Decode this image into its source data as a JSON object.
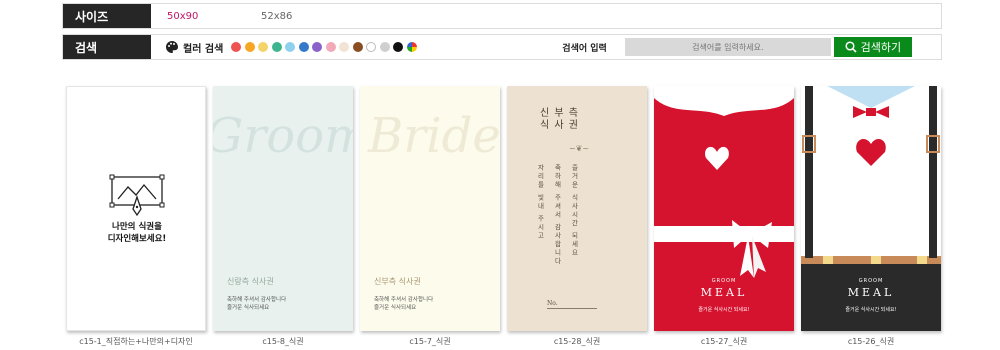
{
  "filter": {
    "size_label": "사이즈",
    "sizes": [
      "50x90",
      "52x86"
    ],
    "search_label": "검색",
    "color_search_label": "컬러 검색",
    "colors": [
      "#ee5252",
      "#f5a623",
      "#f4d36a",
      "#3cb58e",
      "#8fd0ee",
      "#3579c9",
      "#8a62c9",
      "#f2a9b8",
      "#f1e4d4",
      "#8a4d22",
      "#ffffff",
      "#cfcfcf",
      "#111111"
    ],
    "keyword_label": "검색어 입력",
    "keyword_placeholder": "검색어를 입력하세요.",
    "search_button": "검색하기"
  },
  "cards": [
    {
      "caption": "c15-1_직접하는+나만의+디자인",
      "diy_line1": "나만의 식권을",
      "diy_line2": "디자인해보세요!"
    },
    {
      "caption": "c15-8_식권",
      "script": "Groom",
      "title": "신랑측 식사권",
      "text1": "축하해 주셔서 감사합니다",
      "text2": "즐거운 식사되세요"
    },
    {
      "caption": "c15-7_식권",
      "script": "Bride",
      "title": "신부측 식사권",
      "text1": "축하해 주셔서 감사합니다",
      "text2": "즐거운 식사되세요"
    },
    {
      "caption": "c15-28_식권",
      "title1": "신 부 측",
      "title2": "식 사 권",
      "col1": "자리를 빛내 주시고",
      "col2": "축하해 주셔서 감사합니다",
      "col3": "즐거운 식사시간 되세요",
      "no": "No."
    },
    {
      "caption": "c15-27_식권",
      "groom": "GROOM",
      "meal": "MEAL",
      "sub": "즐거운 식사시간 되세요!"
    },
    {
      "caption": "c15-26_식권",
      "groom": "GROOM",
      "meal": "MEAL",
      "sub": "즐거운 식사시간 되세요!"
    }
  ]
}
